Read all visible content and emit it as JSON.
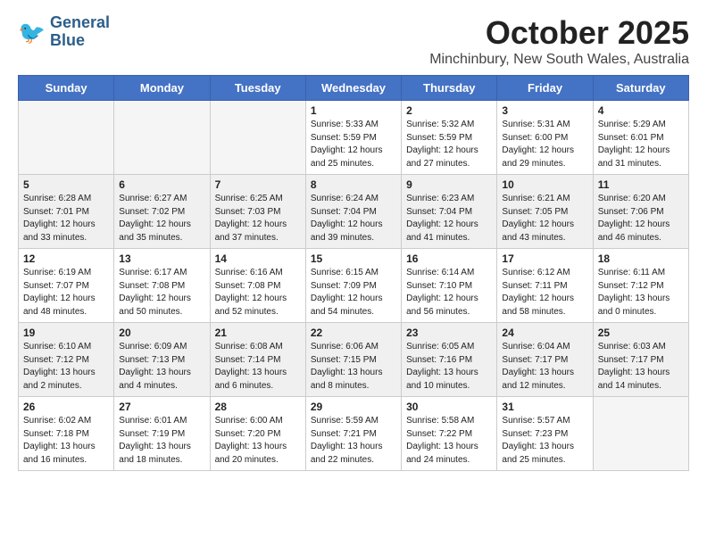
{
  "header": {
    "logo_line1": "General",
    "logo_line2": "Blue",
    "month": "October 2025",
    "location": "Minchinbury, New South Wales, Australia"
  },
  "weekdays": [
    "Sunday",
    "Monday",
    "Tuesday",
    "Wednesday",
    "Thursday",
    "Friday",
    "Saturday"
  ],
  "weeks": [
    [
      {
        "day": "",
        "info": "",
        "empty": true
      },
      {
        "day": "",
        "info": "",
        "empty": true
      },
      {
        "day": "",
        "info": "",
        "empty": true
      },
      {
        "day": "1",
        "info": "Sunrise: 5:33 AM\nSunset: 5:59 PM\nDaylight: 12 hours\nand 25 minutes."
      },
      {
        "day": "2",
        "info": "Sunrise: 5:32 AM\nSunset: 5:59 PM\nDaylight: 12 hours\nand 27 minutes."
      },
      {
        "day": "3",
        "info": "Sunrise: 5:31 AM\nSunset: 6:00 PM\nDaylight: 12 hours\nand 29 minutes."
      },
      {
        "day": "4",
        "info": "Sunrise: 5:29 AM\nSunset: 6:01 PM\nDaylight: 12 hours\nand 31 minutes."
      }
    ],
    [
      {
        "day": "5",
        "info": "Sunrise: 6:28 AM\nSunset: 7:01 PM\nDaylight: 12 hours\nand 33 minutes.",
        "shaded": true
      },
      {
        "day": "6",
        "info": "Sunrise: 6:27 AM\nSunset: 7:02 PM\nDaylight: 12 hours\nand 35 minutes.",
        "shaded": true
      },
      {
        "day": "7",
        "info": "Sunrise: 6:25 AM\nSunset: 7:03 PM\nDaylight: 12 hours\nand 37 minutes.",
        "shaded": true
      },
      {
        "day": "8",
        "info": "Sunrise: 6:24 AM\nSunset: 7:04 PM\nDaylight: 12 hours\nand 39 minutes.",
        "shaded": true
      },
      {
        "day": "9",
        "info": "Sunrise: 6:23 AM\nSunset: 7:04 PM\nDaylight: 12 hours\nand 41 minutes.",
        "shaded": true
      },
      {
        "day": "10",
        "info": "Sunrise: 6:21 AM\nSunset: 7:05 PM\nDaylight: 12 hours\nand 43 minutes.",
        "shaded": true
      },
      {
        "day": "11",
        "info": "Sunrise: 6:20 AM\nSunset: 7:06 PM\nDaylight: 12 hours\nand 46 minutes.",
        "shaded": true
      }
    ],
    [
      {
        "day": "12",
        "info": "Sunrise: 6:19 AM\nSunset: 7:07 PM\nDaylight: 12 hours\nand 48 minutes."
      },
      {
        "day": "13",
        "info": "Sunrise: 6:17 AM\nSunset: 7:08 PM\nDaylight: 12 hours\nand 50 minutes."
      },
      {
        "day": "14",
        "info": "Sunrise: 6:16 AM\nSunset: 7:08 PM\nDaylight: 12 hours\nand 52 minutes."
      },
      {
        "day": "15",
        "info": "Sunrise: 6:15 AM\nSunset: 7:09 PM\nDaylight: 12 hours\nand 54 minutes."
      },
      {
        "day": "16",
        "info": "Sunrise: 6:14 AM\nSunset: 7:10 PM\nDaylight: 12 hours\nand 56 minutes."
      },
      {
        "day": "17",
        "info": "Sunrise: 6:12 AM\nSunset: 7:11 PM\nDaylight: 12 hours\nand 58 minutes."
      },
      {
        "day": "18",
        "info": "Sunrise: 6:11 AM\nSunset: 7:12 PM\nDaylight: 13 hours\nand 0 minutes."
      }
    ],
    [
      {
        "day": "19",
        "info": "Sunrise: 6:10 AM\nSunset: 7:12 PM\nDaylight: 13 hours\nand 2 minutes.",
        "shaded": true
      },
      {
        "day": "20",
        "info": "Sunrise: 6:09 AM\nSunset: 7:13 PM\nDaylight: 13 hours\nand 4 minutes.",
        "shaded": true
      },
      {
        "day": "21",
        "info": "Sunrise: 6:08 AM\nSunset: 7:14 PM\nDaylight: 13 hours\nand 6 minutes.",
        "shaded": true
      },
      {
        "day": "22",
        "info": "Sunrise: 6:06 AM\nSunset: 7:15 PM\nDaylight: 13 hours\nand 8 minutes.",
        "shaded": true
      },
      {
        "day": "23",
        "info": "Sunrise: 6:05 AM\nSunset: 7:16 PM\nDaylight: 13 hours\nand 10 minutes.",
        "shaded": true
      },
      {
        "day": "24",
        "info": "Sunrise: 6:04 AM\nSunset: 7:17 PM\nDaylight: 13 hours\nand 12 minutes.",
        "shaded": true
      },
      {
        "day": "25",
        "info": "Sunrise: 6:03 AM\nSunset: 7:17 PM\nDaylight: 13 hours\nand 14 minutes.",
        "shaded": true
      }
    ],
    [
      {
        "day": "26",
        "info": "Sunrise: 6:02 AM\nSunset: 7:18 PM\nDaylight: 13 hours\nand 16 minutes."
      },
      {
        "day": "27",
        "info": "Sunrise: 6:01 AM\nSunset: 7:19 PM\nDaylight: 13 hours\nand 18 minutes."
      },
      {
        "day": "28",
        "info": "Sunrise: 6:00 AM\nSunset: 7:20 PM\nDaylight: 13 hours\nand 20 minutes."
      },
      {
        "day": "29",
        "info": "Sunrise: 5:59 AM\nSunset: 7:21 PM\nDaylight: 13 hours\nand 22 minutes."
      },
      {
        "day": "30",
        "info": "Sunrise: 5:58 AM\nSunset: 7:22 PM\nDaylight: 13 hours\nand 24 minutes."
      },
      {
        "day": "31",
        "info": "Sunrise: 5:57 AM\nSunset: 7:23 PM\nDaylight: 13 hours\nand 25 minutes."
      },
      {
        "day": "",
        "info": "",
        "empty": true
      }
    ]
  ]
}
